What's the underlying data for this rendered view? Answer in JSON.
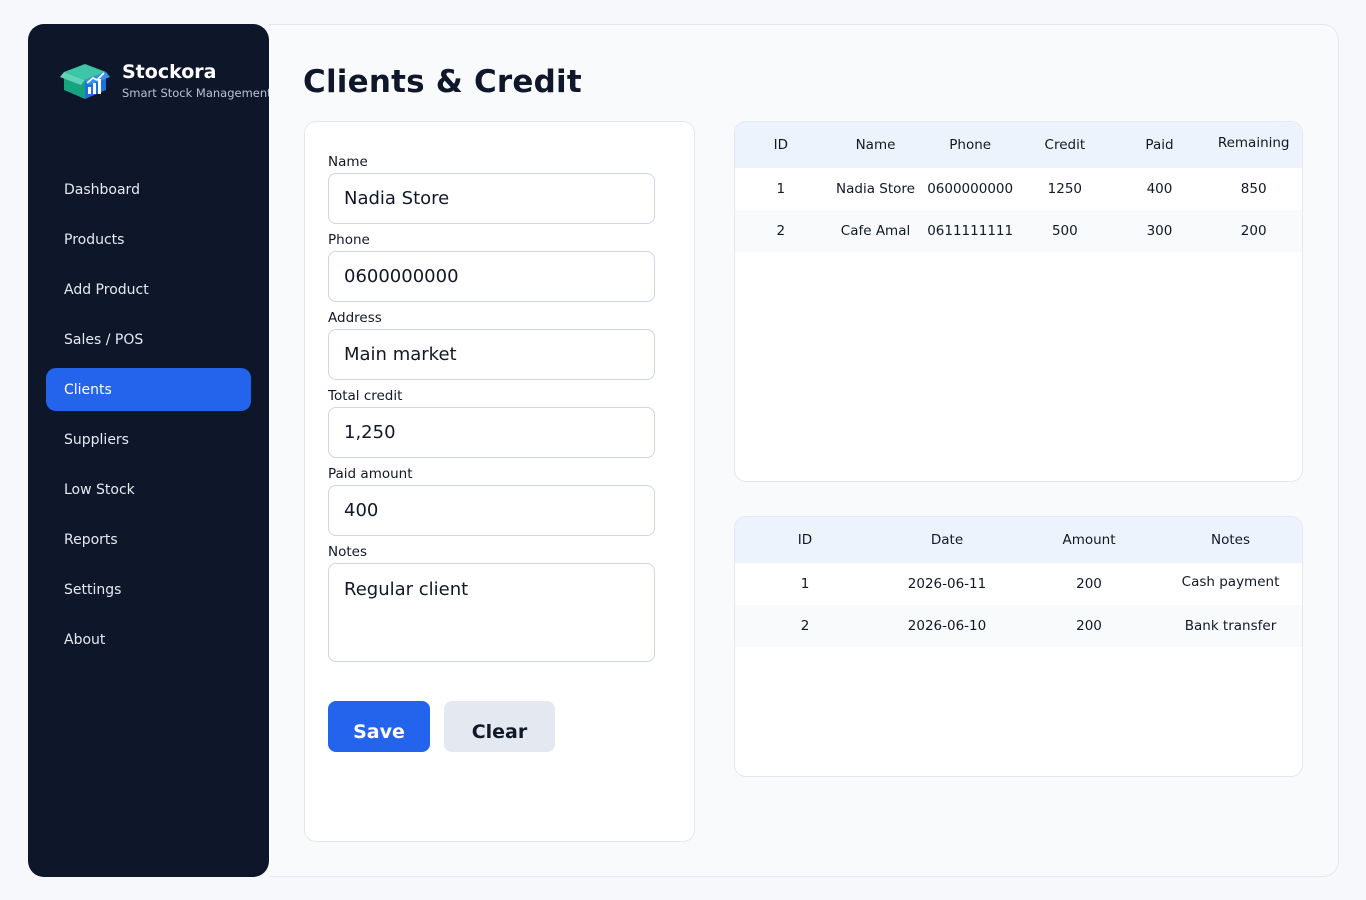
{
  "brand": {
    "name": "Stockora",
    "tagline": "Smart Stock Management"
  },
  "nav": {
    "items": [
      {
        "label": "Dashboard"
      },
      {
        "label": "Products"
      },
      {
        "label": "Add Product"
      },
      {
        "label": "Sales / POS"
      },
      {
        "label": "Clients"
      },
      {
        "label": "Suppliers"
      },
      {
        "label": "Low Stock"
      },
      {
        "label": "Reports"
      },
      {
        "label": "Settings"
      },
      {
        "label": "About"
      }
    ],
    "active": "Clients"
  },
  "page": {
    "title": "Clients & Credit"
  },
  "form": {
    "name_label": "Name",
    "name_value": "Nadia Store",
    "phone_label": "Phone",
    "phone_value": "0600000000",
    "address_label": "Address",
    "address_value": "Main market",
    "credit_label": "Total credit",
    "credit_value": "1,250",
    "paid_label": "Paid amount",
    "paid_value": "400",
    "notes_label": "Notes",
    "notes_value": "Regular client",
    "save_label": "Save",
    "clear_label": "Clear"
  },
  "clients_table": {
    "headers": [
      "ID",
      "Name",
      "Phone",
      "Credit",
      "Paid",
      "Remaining"
    ],
    "rows": [
      [
        "1",
        "Nadia Store",
        "0600000000",
        "1250",
        "400",
        "850"
      ],
      [
        "2",
        "Cafe Amal",
        "0611111111",
        "500",
        "300",
        "200"
      ]
    ]
  },
  "payments_table": {
    "headers": [
      "ID",
      "Date",
      "Amount",
      "Notes"
    ],
    "rows": [
      [
        "1",
        "2026-06-11",
        "200",
        "Cash payment"
      ],
      [
        "2",
        "2026-06-10",
        "200",
        "Bank transfer"
      ]
    ]
  },
  "colors": {
    "sidebar_bg": "#0e172a",
    "accent": "#2463eb",
    "table_header": "#edf3fc"
  }
}
